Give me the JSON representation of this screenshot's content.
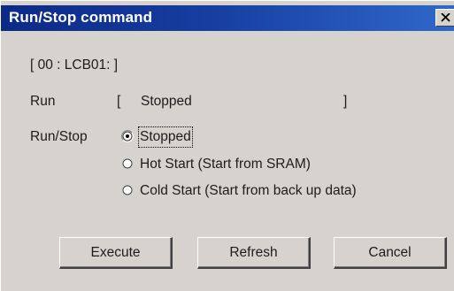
{
  "window": {
    "title": "Run/Stop command",
    "close_symbol": "×"
  },
  "device": {
    "id_label": "[ 00 : LCB01: ]"
  },
  "status": {
    "label": "Run",
    "bracket_open": "[",
    "value": "Stopped",
    "bracket_close": "]"
  },
  "run_stop": {
    "label": "Run/Stop",
    "selected": "Stopped",
    "options": [
      {
        "label": "Stopped"
      },
      {
        "label": "Hot Start (Start from SRAM)"
      },
      {
        "label": "Cold Start (Start from back up data)"
      }
    ]
  },
  "buttons": {
    "execute": "Execute",
    "refresh": "Refresh",
    "cancel": "Cancel"
  }
}
